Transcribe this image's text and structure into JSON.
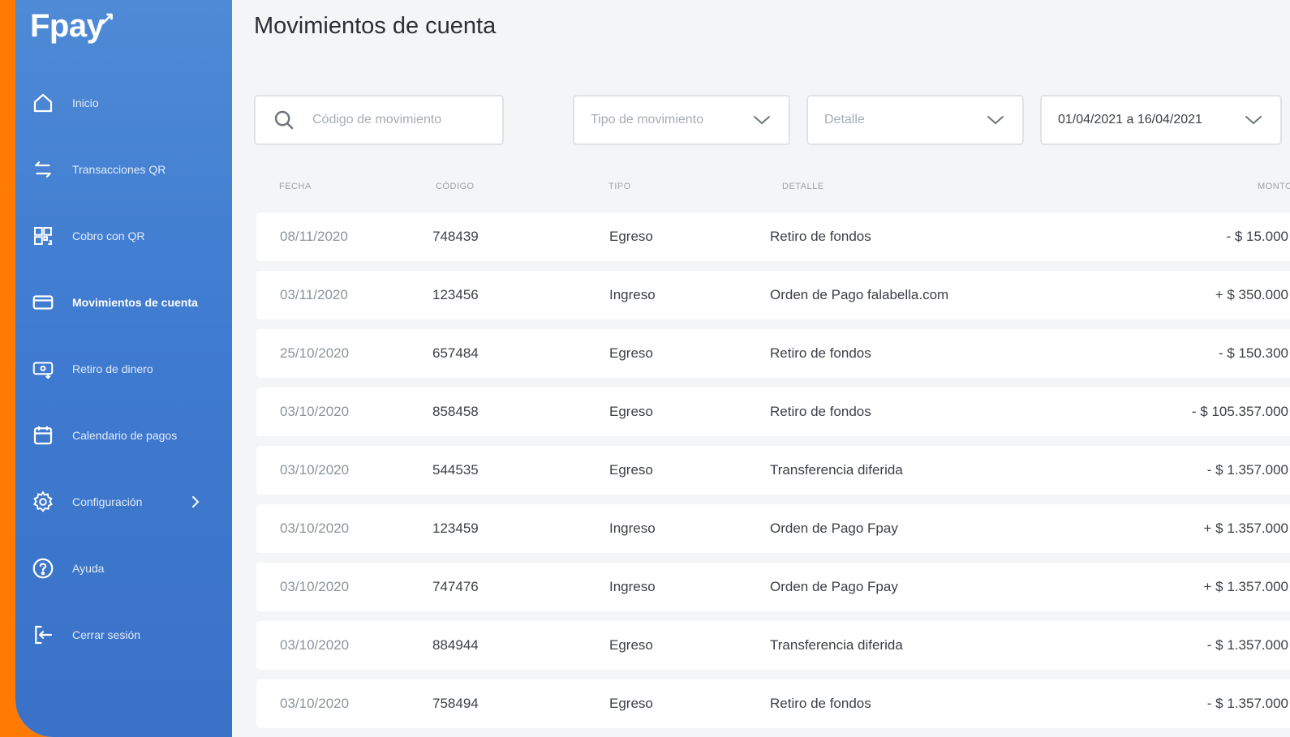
{
  "app": {
    "logo": "Fpay"
  },
  "colors": {
    "frame": "#ff7a00",
    "sidebar": "#3f7bd0",
    "background": "#f4f5f6"
  },
  "sidebar": {
    "items": [
      {
        "label": "Inicio",
        "icon": "home-icon"
      },
      {
        "label": "Transacciones QR",
        "icon": "swap-arrows-icon"
      },
      {
        "label": "Cobro con QR",
        "icon": "qr-code-icon"
      },
      {
        "label": "Movimientos de cuenta",
        "icon": "card-icon",
        "active": true
      },
      {
        "label": "Retiro de dinero",
        "icon": "cash-withdraw-icon"
      },
      {
        "label": "Calendario de pagos",
        "icon": "calendar-icon"
      },
      {
        "label": "Configuración",
        "icon": "gear-icon"
      },
      {
        "label": "Ayuda",
        "icon": "help-circle-icon"
      },
      {
        "label": "Cerrar sesión",
        "icon": "logout-icon"
      }
    ]
  },
  "page": {
    "title": "Movimientos de cuenta"
  },
  "filters": {
    "search_placeholder": "Código de movimiento",
    "type_placeholder": "Tipo de movimiento",
    "detail_placeholder": "Detalle",
    "date_range": "01/04/2021 a 16/04/2021"
  },
  "table": {
    "headers": {
      "date": "FECHA",
      "code": "CÓDIGO",
      "type": "TIPO",
      "detail": "DETALLE",
      "amount": "MONTO"
    },
    "rows": [
      {
        "date": "08/11/2020",
        "code": "748439",
        "type": "Egreso",
        "detail": "Retiro de fondos",
        "amount": "- $ 15.000"
      },
      {
        "date": "03/11/2020",
        "code": "123456",
        "type": "Ingreso",
        "detail": "Orden de Pago falabella.com",
        "amount": "+ $ 350.000"
      },
      {
        "date": "25/10/2020",
        "code": "657484",
        "type": "Egreso",
        "detail": "Retiro de fondos",
        "amount": "- $ 150.300"
      },
      {
        "date": "03/10/2020",
        "code": "858458",
        "type": "Egreso",
        "detail": "Retiro de fondos",
        "amount": "- $ 105.357.000"
      },
      {
        "date": "03/10/2020",
        "code": "544535",
        "type": "Egreso",
        "detail": "Transferencia diferida",
        "amount": "- $ 1.357.000"
      },
      {
        "date": "03/10/2020",
        "code": "123459",
        "type": "Ingreso",
        "detail": "Orden de Pago Fpay",
        "amount": "+ $ 1.357.000"
      },
      {
        "date": "03/10/2020",
        "code": "747476",
        "type": "Ingreso",
        "detail": "Orden de Pago Fpay",
        "amount": "+ $ 1.357.000"
      },
      {
        "date": "03/10/2020",
        "code": "884944",
        "type": "Egreso",
        "detail": "Transferencia diferida",
        "amount": "- $ 1.357.000"
      },
      {
        "date": "03/10/2020",
        "code": "758494",
        "type": "Egreso",
        "detail": "Retiro de fondos",
        "amount": "- $ 1.357.000"
      }
    ]
  }
}
